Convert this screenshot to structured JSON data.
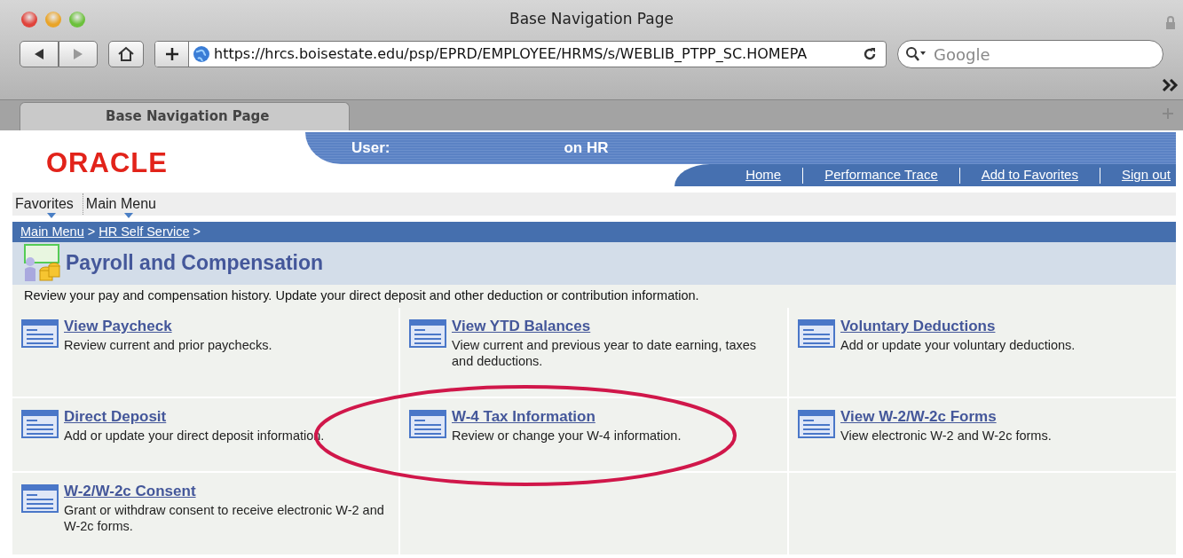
{
  "window": {
    "title": "Base Navigation Page"
  },
  "toolbar": {
    "url": "https://hrcs.boisestate.edu/psp/EPRD/EMPLOYEE/HRMS/s/WEBLIB_PTPP_SC.HOMEPA",
    "search_placeholder": "Google"
  },
  "tabs": [
    {
      "label": "Base Navigation Page",
      "selected": true
    }
  ],
  "header": {
    "logo": "ORACLE",
    "user_label": "User:",
    "user_suffix": "on HR",
    "links": [
      "Home",
      "Performance Trace",
      "Add to Favorites",
      "Sign out"
    ]
  },
  "menu": [
    "Favorites",
    "Main Menu"
  ],
  "breadcrumb": [
    {
      "kind": "link",
      "label": "Main Menu"
    },
    {
      "kind": "separator",
      "label": ">"
    },
    {
      "kind": "link",
      "label": "HR Self Service"
    },
    {
      "kind": "separator",
      "label": ">"
    }
  ],
  "page": {
    "title": "Payroll and Compensation",
    "description": "Review your pay and compensation history. Update your direct deposit and other deduction or contribution information."
  },
  "tiles": [
    {
      "title": "View Paycheck",
      "description": "Review current and prior paychecks.",
      "circled": false
    },
    {
      "title": "View YTD Balances",
      "description": "View current and previous year to date earning, taxes and deductions.",
      "circled": false
    },
    {
      "title": "Voluntary Deductions",
      "description": "Add or update your voluntary deductions.",
      "circled": false
    },
    {
      "title": "Direct Deposit",
      "description": "Add or update your direct deposit information.",
      "circled": false
    },
    {
      "title": "W-4 Tax Information",
      "description": "Review or change your W-4 information.",
      "circled": true
    },
    {
      "title": "View W-2/W-2c Forms",
      "description": "View electronic W-2 and W-2c forms.",
      "circled": false
    },
    {
      "title": "W-2/W-2c Consent",
      "description": "Grant or withdraw consent to receive electronic W-2 and W-2c forms.",
      "circled": false
    }
  ]
}
